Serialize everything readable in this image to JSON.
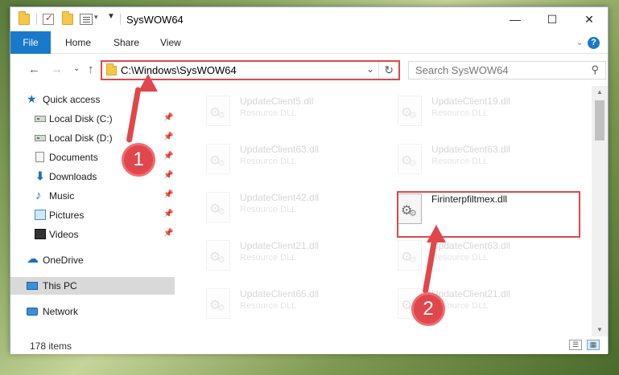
{
  "window": {
    "title": "SysWOW64",
    "minimize_glyph": "—",
    "maximize_glyph": "☐",
    "close_glyph": "✕"
  },
  "ribbon": {
    "file_label": "File",
    "tabs": [
      "Home",
      "Share",
      "View"
    ]
  },
  "navigation": {
    "address_path": "C:\\Windows\\SysWOW64",
    "search_placeholder": "Search SysWOW64"
  },
  "sidebar": {
    "items": [
      {
        "label": "Quick access",
        "icon": "star-icon",
        "pinned": false
      },
      {
        "label": "Local Disk (C:)",
        "icon": "drive-icon",
        "pinned": true
      },
      {
        "label": "Local Disk (D:)",
        "icon": "drive-icon",
        "pinned": true
      },
      {
        "label": "Documents",
        "icon": "documents-icon",
        "pinned": true
      },
      {
        "label": "Downloads",
        "icon": "downloads-icon",
        "pinned": true
      },
      {
        "label": "Music",
        "icon": "music-icon",
        "pinned": true
      },
      {
        "label": "Pictures",
        "icon": "pictures-icon",
        "pinned": true
      },
      {
        "label": "Videos",
        "icon": "videos-icon",
        "pinned": true
      },
      {
        "label": "OneDrive",
        "icon": "onedrive-icon",
        "pinned": false
      },
      {
        "label": "This PC",
        "icon": "this-pc-icon",
        "pinned": false,
        "selected": true
      },
      {
        "label": "Network",
        "icon": "network-icon",
        "pinned": false
      }
    ]
  },
  "files": [
    {
      "name": "UpdateClient5.dll",
      "type": "Resource DLL",
      "faded": true
    },
    {
      "name": "UpdateClient19.dll",
      "type": "Resource DLL",
      "faded": true
    },
    {
      "name": "UpdateClient63.dll",
      "type": "Resource DLL",
      "faded": true
    },
    {
      "name": "UpdateClient63.dll",
      "type": "Resource DLL",
      "faded": true
    },
    {
      "name": "UpdateClient42.dll",
      "type": "Resource DLL",
      "faded": true
    },
    {
      "name": "Firinterpfiltmex.dll",
      "type": "",
      "faded": false
    },
    {
      "name": "UpdateClient21.dll",
      "type": "Resource DLL",
      "faded": true
    },
    {
      "name": "UpdateClient63.dll",
      "type": "Resource DLL",
      "faded": true
    },
    {
      "name": "UpdateClient65.dll",
      "type": "Resource DLL",
      "faded": true
    },
    {
      "name": "UpdateClient21.dll",
      "type": "Resource DLL",
      "faded": true
    }
  ],
  "status": {
    "item_count": "178 items"
  },
  "annotations": {
    "step1": "1",
    "step2": "2",
    "color": "#e0474c"
  }
}
